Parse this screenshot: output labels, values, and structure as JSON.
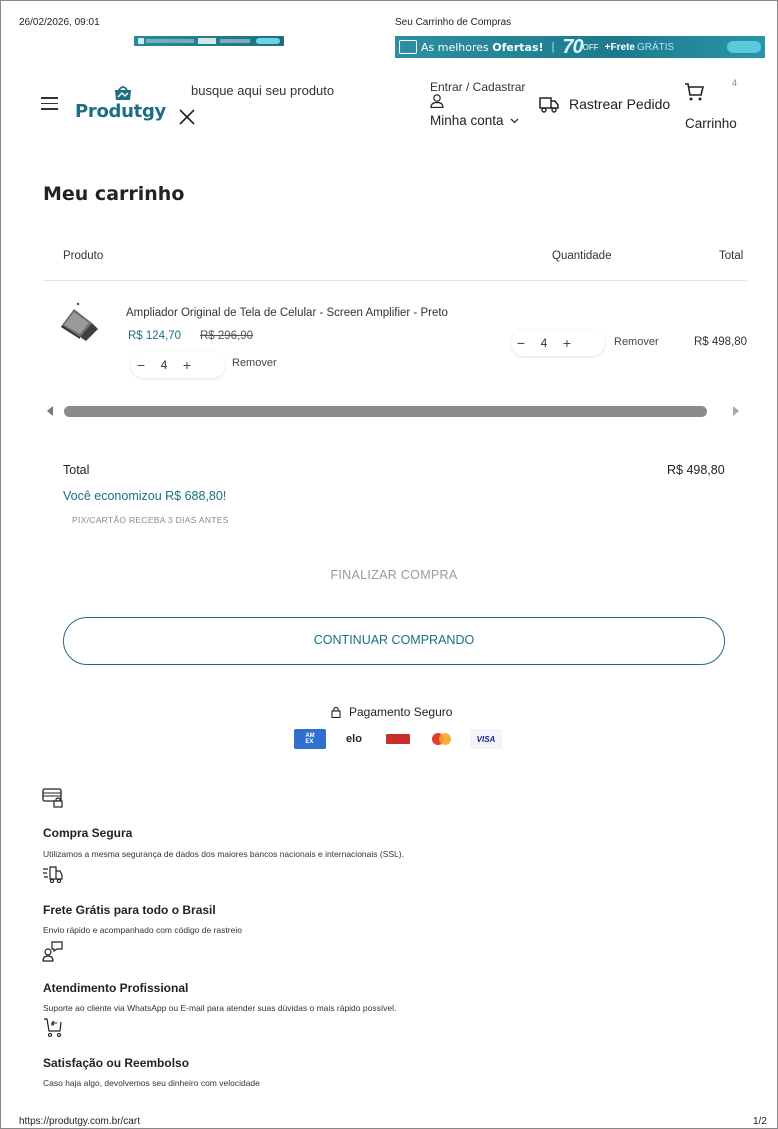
{
  "print": {
    "datetime": "26/02/2026, 09:01",
    "title": "Seu Carrinho de Compras",
    "url": "https://produtgy.com.br/cart",
    "page": "1/2"
  },
  "promo": {
    "text_a": "As melhores ",
    "text_b": "Ofertas!",
    "pct": "70",
    "off": "OFF",
    "frete": "+Frete",
    "gratis": "GRÁTIS"
  },
  "header": {
    "logo_text": "Produtgy",
    "search_placeholder": "busque aqui seu produto",
    "login_label": "Entrar / Cadastrar",
    "account_label": "Minha conta",
    "track_label": "Rastrear Pedido",
    "cart_count": "4",
    "cart_label": "Carrinho"
  },
  "cart": {
    "heading": "Meu carrinho",
    "columns": {
      "product": "Produto",
      "quantity": "Quantidade",
      "total": "Total"
    },
    "items": [
      {
        "name": "Ampliador Original de Tela de Celular - Screen Amplifier - Preto",
        "price": "R$ 124,70",
        "old_price": "R$ 296,90",
        "quantity": "4",
        "remove_label": "Remover",
        "line_total": "R$ 498,80"
      }
    ],
    "summary": {
      "total_label": "Total",
      "total_value": "R$ 498,80",
      "savings": "Você economizou R$ 688,80!",
      "pix_note": "PIX/CARTÃO RECEBA 3 DIAS ANTES"
    },
    "finalize_label": "FINALIZAR COMPRA",
    "continue_label": "CONTINUAR COMPRANDO"
  },
  "payment": {
    "secure_label": "Pagamento Seguro",
    "methods": [
      "amex",
      "elo",
      "hipercard",
      "mastercard",
      "visa"
    ],
    "elo_text": "elo",
    "visa_text": "VISA"
  },
  "features": [
    {
      "icon": "secure-card-icon",
      "title": "Compra Segura",
      "text": "Utilizamos a mesma segurança de dados dos maiores bancos nacionais e internacionais (SSL)."
    },
    {
      "icon": "fast-delivery-icon",
      "title": "Frete Grátis para todo o Brasil",
      "text": "Envio rápido e acompanhado com código de rastreio"
    },
    {
      "icon": "support-agent-icon",
      "title": "Atendimento Profissional",
      "text": "Suporte ao cliente via WhatsApp ou E-mail para atender suas dúvidas o mais rápido possível."
    },
    {
      "icon": "return-cart-icon",
      "title": "Satisfação ou Reembolso",
      "text": "Caso haja algo, devolvemos seu dinheiro com velocidade"
    }
  ],
  "colors": {
    "brand": "#1c6f80",
    "promo": "#1d7a8e"
  }
}
